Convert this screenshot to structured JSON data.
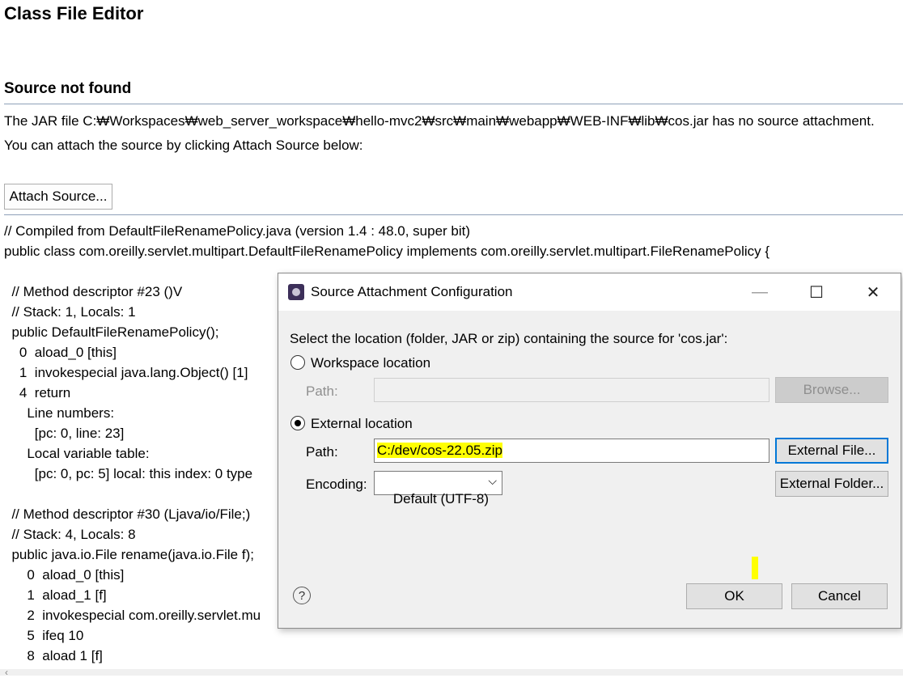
{
  "editor": {
    "title": "Class File Editor",
    "section_title": "Source not found",
    "message_line1": "The JAR file C:₩Workspaces₩web_server_workspace₩hello-mvc2₩src₩main₩webapp₩WEB-INF₩lib₩cos.jar has no source attachment.",
    "message_line2": "You can attach the source by clicking Attach Source below:",
    "attach_button": "Attach Source...",
    "code_lines": [
      "// Compiled from DefaultFileRenamePolicy.java (version 1.4 : 48.0, super bit)",
      "public class com.oreilly.servlet.multipart.DefaultFileRenamePolicy implements com.oreilly.servlet.multipart.FileRenamePolicy {",
      "",
      "  // Method descriptor #23 ()V",
      "  // Stack: 1, Locals: 1",
      "  public DefaultFileRenamePolicy();",
      "    0  aload_0 [this]",
      "    1  invokespecial java.lang.Object() [1]",
      "    4  return",
      "      Line numbers:",
      "        [pc: 0, line: 23]",
      "      Local variable table:",
      "        [pc: 0, pc: 5] local: this index: 0 type",
      "",
      "  // Method descriptor #30 (Ljava/io/File;)",
      "  // Stack: 4, Locals: 8",
      "  public java.io.File rename(java.io.File f);",
      "      0  aload_0 [this]",
      "      1  aload_1 [f]",
      "      2  invokespecial com.oreilly.servlet.mu",
      "      5  ifeq 10",
      "      8  aload 1 [f]"
    ]
  },
  "dialog": {
    "title": "Source Attachment Configuration",
    "prompt": "Select the location (folder, JAR or zip) containing the source for 'cos.jar':",
    "workspace_option": "Workspace location",
    "workspace_path_label": "Path:",
    "workspace_path_value": "",
    "browse_button": "Browse...",
    "external_option": "External location",
    "external_path_label": "Path:",
    "external_path_value": "C:/dev/cos-22.05.zip",
    "external_file_button": "External File...",
    "encoding_label": "Encoding:",
    "encoding_value": "Default (UTF-8)",
    "external_folder_button": "External Folder...",
    "help_icon": "?",
    "ok_button": "OK",
    "cancel_button": "Cancel",
    "window_minimize": "—",
    "window_maximize": "☐",
    "window_close": "✕"
  }
}
